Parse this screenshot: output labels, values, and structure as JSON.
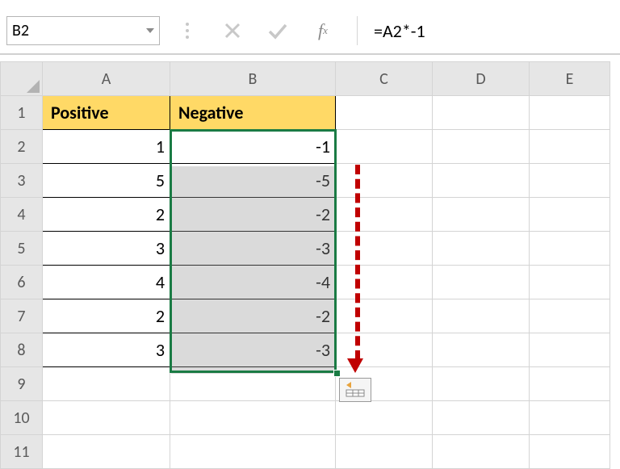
{
  "formula_bar": {
    "name_box": "B2",
    "formula": "=A2*-1"
  },
  "columns": {
    "A": "A",
    "B": "B",
    "C": "C",
    "D": "D",
    "E": "E"
  },
  "rows": [
    "1",
    "2",
    "3",
    "4",
    "5",
    "6",
    "7",
    "8",
    "9",
    "10",
    "11"
  ],
  "headers": {
    "A": "Positive",
    "B": "Negative"
  },
  "data": {
    "A": [
      1,
      5,
      2,
      3,
      4,
      2,
      3
    ],
    "B": [
      -1,
      -5,
      -2,
      -3,
      -4,
      -2,
      -3
    ]
  },
  "selection": {
    "active_cell": "B2",
    "range": "B2:B8"
  },
  "chart_data": {
    "type": "table",
    "columns": [
      "Positive",
      "Negative"
    ],
    "rows": [
      [
        1,
        -1
      ],
      [
        5,
        -5
      ],
      [
        2,
        -2
      ],
      [
        3,
        -3
      ],
      [
        4,
        -4
      ],
      [
        2,
        -2
      ],
      [
        3,
        -3
      ]
    ]
  }
}
